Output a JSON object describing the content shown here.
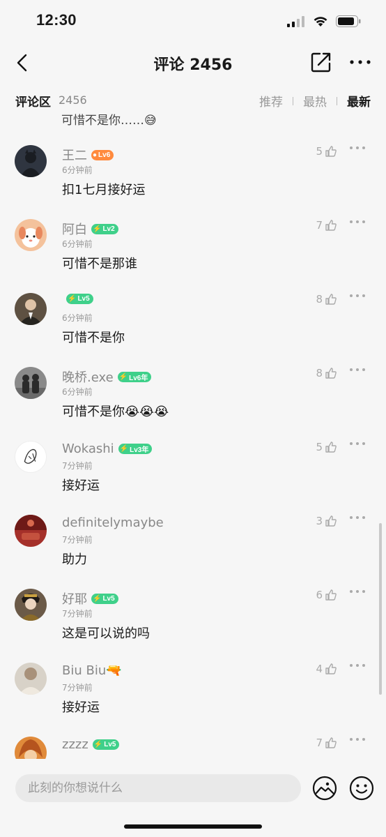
{
  "status_bar": {
    "time": "12:30"
  },
  "nav": {
    "title": "评论 2456"
  },
  "section": {
    "title": "评论区",
    "count": "2456",
    "sort_tabs": [
      "推荐",
      "最热",
      "最新"
    ],
    "active_sort": "最新"
  },
  "clipped_comment_text": "可惜不是你……😅",
  "comments": [
    {
      "name": "王二",
      "badge": "Lv6",
      "badge_color": "#ff8a3d",
      "time": "6分钟前",
      "text": "扣1七月接好运",
      "likes": "5",
      "avatar_color": "#3a4250"
    },
    {
      "name": "阿白",
      "badge": "Lv2",
      "badge_color": "#3fd08a",
      "time": "6分钟前",
      "text": "可惜不是那谁",
      "likes": "7",
      "avatar_color": "#f5c2a0"
    },
    {
      "name": "",
      "badge": "Lv5",
      "badge_color": "#3fd08a",
      "time": "6分钟前",
      "text": "可惜不是你",
      "likes": "8",
      "avatar_color": "#6b5a4a"
    },
    {
      "name": "晚桥.exe",
      "badge": "Lv6年",
      "badge_color": "#3fd08a",
      "time": "6分钟前",
      "text": "可惜不是你😭😭😭",
      "likes": "8",
      "avatar_color": "#7a7a7a"
    },
    {
      "name": "Wokashi",
      "badge": "Lv3年",
      "badge_color": "#3fd08a",
      "time": "7分钟前",
      "text": "接好运",
      "likes": "5",
      "avatar_color": "#ffffff"
    },
    {
      "name": "definitelymaybe",
      "badge": "",
      "badge_color": "",
      "time": "7分钟前",
      "text": "助力",
      "likes": "3",
      "avatar_color": "#a8332b"
    },
    {
      "name": "好耶",
      "badge": "Lv5",
      "badge_color": "#3fd08a",
      "time": "7分钟前",
      "text": "这是可以说的吗",
      "likes": "6",
      "avatar_color": "#4a3b30"
    },
    {
      "name": "Biu Biu🔫",
      "badge": "",
      "badge_color": "",
      "time": "7分钟前",
      "text": "接好运",
      "likes": "4",
      "avatar_color": "#c8c0b4"
    },
    {
      "name": "zzzz",
      "badge": "Lv5",
      "badge_color": "#3fd08a",
      "time": "",
      "text": "",
      "likes": "7",
      "avatar_color": "#d9722a"
    }
  ],
  "input": {
    "placeholder": "此刻的你想说什么"
  },
  "icons": {
    "back": "chevron-left-icon",
    "share": "share-icon",
    "more": "more-icon",
    "like": "thumbs-up-icon",
    "image": "image-icon",
    "emoji": "emoji-icon"
  }
}
